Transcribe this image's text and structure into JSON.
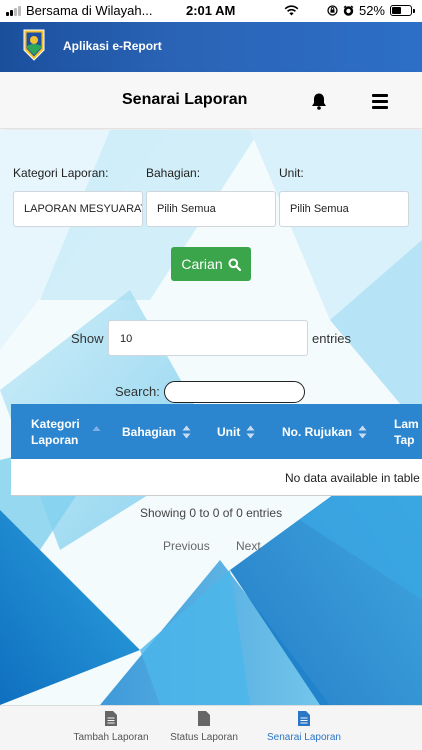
{
  "status_bar": {
    "carrier": "Bersama di Wilayah...",
    "time": "2:01 AM",
    "battery": "52%",
    "battery_level": 0.52
  },
  "app": {
    "title": "Aplikasi e-Report"
  },
  "header": {
    "page_title": "Senarai Laporan",
    "icons": [
      "bell-icon",
      "menu-icon"
    ]
  },
  "filters": {
    "kategori": {
      "label": "Kategori Laporan:",
      "value": "LAPORAN MESYUARAT"
    },
    "bahagian": {
      "label": "Bahagian:",
      "value": "Pilih Semua"
    },
    "unit": {
      "label": "Unit:",
      "value": "Pilih Semua"
    },
    "search_button": "Carian"
  },
  "table_controls": {
    "show_label": "Show",
    "page_length": "10",
    "entries_label": "entries",
    "search_label": "Search:",
    "search_value": ""
  },
  "table": {
    "columns": [
      "Kategori Laporan",
      "Bahagian",
      "Unit",
      "No. Rujukan",
      "Lam Tap"
    ],
    "empty_message": "No data available in table",
    "info": "Showing 0 to 0 of 0 entries",
    "pagination": {
      "previous": "Previous",
      "next": "Next"
    }
  },
  "tabs": [
    {
      "label": "Tambah Laporan",
      "icon": "document-icon",
      "active": false
    },
    {
      "label": "Status Laporan",
      "icon": "document-icon",
      "active": false
    },
    {
      "label": "Senarai Laporan",
      "icon": "document-list-icon",
      "active": true
    }
  ],
  "colors": {
    "app_bar": "#2a63b5",
    "table_header": "#2b86cf",
    "search_button": "#3aa54a",
    "active_tab": "#2b76c6"
  }
}
